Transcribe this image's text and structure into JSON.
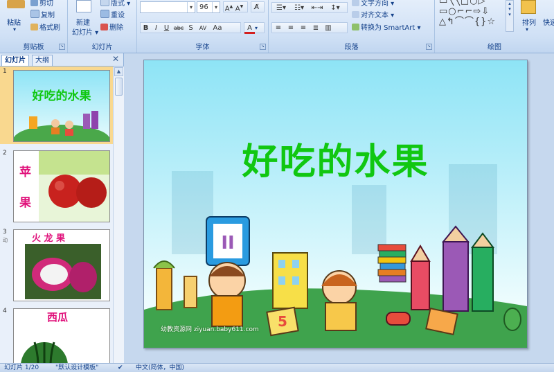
{
  "ribbon": {
    "clipboard": {
      "label": "剪贴板",
      "paste": "粘贴",
      "cut": "剪切",
      "copy": "复制",
      "format_painter": "格式刷"
    },
    "slides": {
      "label": "幻灯片",
      "new_slide_line1": "新建",
      "new_slide_line2": "幻灯片",
      "layout": "版式",
      "reset": "重设",
      "delete": "删除"
    },
    "font": {
      "label": "字体",
      "font_name": "",
      "font_size": "96"
    },
    "paragraph": {
      "label": "段落",
      "text_direction": "文字方向",
      "align_text": "对齐文本",
      "smartart": "转换为 SmartArt"
    },
    "drawing": {
      "label": "绘图",
      "arrange": "排列",
      "quick_styles": "快速"
    }
  },
  "panel": {
    "tabs": [
      "幻灯片",
      "大纲"
    ],
    "slides": [
      {
        "number": "1",
        "title": "好吃的水果"
      },
      {
        "number": "2",
        "title_chars": [
          "苹",
          "果"
        ]
      },
      {
        "number": "3",
        "title": "火 龙 果",
        "sub": "动"
      },
      {
        "number": "4",
        "title": "西瓜"
      }
    ]
  },
  "slide": {
    "title": "好吃的水果",
    "watermark": "幼教资源网 ziyuan.baby611.com"
  },
  "status": {
    "slide_count": "幻灯片 1/20",
    "theme": "\"默认设计模板\"",
    "language": "中文(简体，中国)"
  },
  "colors": {
    "title_green": "#11c711",
    "ribbon_bg": "#cfe0f5",
    "apple_red": "#c8221e"
  }
}
